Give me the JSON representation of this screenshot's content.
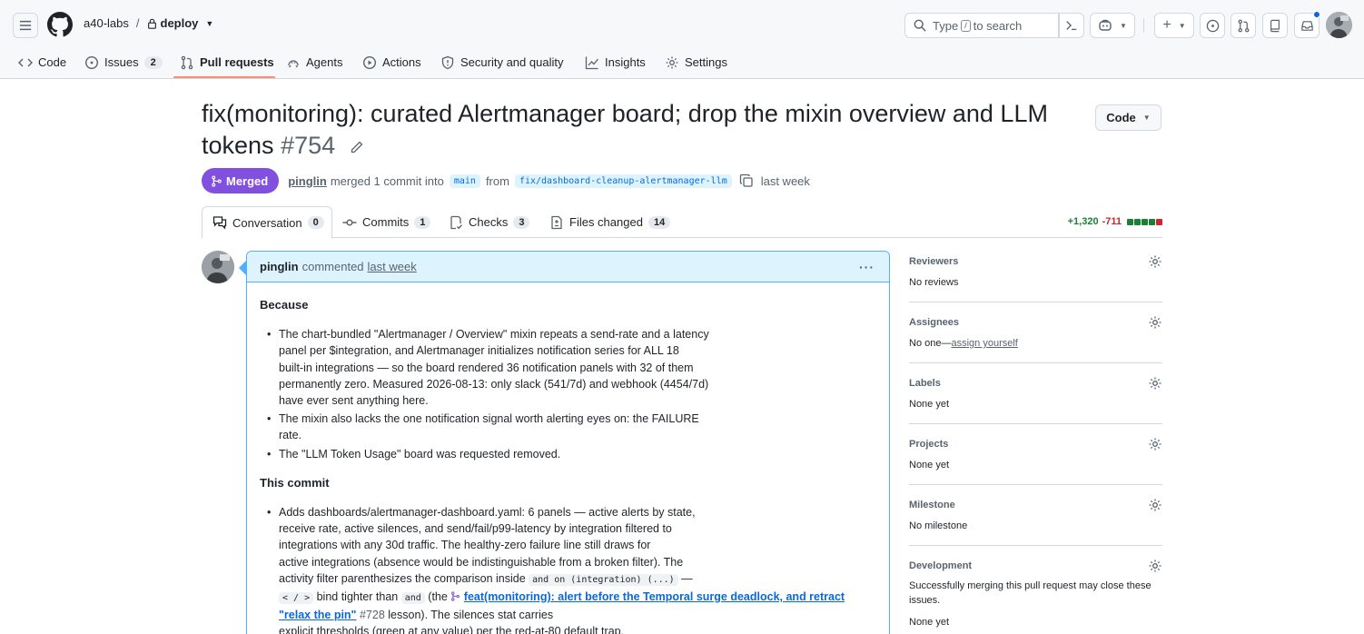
{
  "header": {
    "org": "a40-labs",
    "repo": "deploy",
    "search_prefix": "Type",
    "search_kbd": "/",
    "search_suffix": "to search",
    "plus": "+"
  },
  "repo_nav": [
    {
      "label": "Code",
      "icon": "code-icon"
    },
    {
      "label": "Issues",
      "count": "2",
      "icon": "issue-icon"
    },
    {
      "label": "Pull requests",
      "icon": "git-pull-request-icon",
      "active": true
    },
    {
      "label": "Agents",
      "icon": "agents-icon"
    },
    {
      "label": "Actions",
      "icon": "play-icon"
    },
    {
      "label": "Security and quality",
      "icon": "shield-icon"
    },
    {
      "label": "Insights",
      "icon": "graph-icon"
    },
    {
      "label": "Settings",
      "icon": "gear-icon"
    }
  ],
  "pr": {
    "title": "fix(monitoring): curated Alertmanager board; drop the mixin overview and LLM tokens",
    "number": "#754",
    "code_button": "Code",
    "state": "Merged",
    "author": "pinglin",
    "merged_text": "merged 1 commit into",
    "base_branch": "main",
    "from_text": "from",
    "head_branch": "fix/dashboard-cleanup-alertmanager-llm",
    "when": "last week"
  },
  "tabs": [
    {
      "label": "Conversation",
      "count": "0",
      "icon": "comment-discussion-icon"
    },
    {
      "label": "Commits",
      "count": "1",
      "icon": "git-commit-icon"
    },
    {
      "label": "Checks",
      "count": "3",
      "icon": "checklist-icon"
    },
    {
      "label": "Files changed",
      "count": "14",
      "icon": "file-diff-icon"
    }
  ],
  "diffstat": {
    "additions": "+1,320",
    "deletions": "-711",
    "blocks": [
      "#1a7f37",
      "#1a7f37",
      "#1a7f37",
      "#1a7f37",
      "#d1242f"
    ]
  },
  "comment": {
    "author": "pinglin",
    "action": "commented",
    "when": "last week",
    "heading1": "Because",
    "because": [
      [
        "The chart-bundled \"Alertmanager / Overview\" mixin repeats a send-rate and a latency",
        "panel per $integration, and Alertmanager initializes notification series for ALL 18",
        "built-in integrations — so the board rendered 36 notification panels with 32 of them",
        "permanently zero. Measured 2026-08-13: only slack (541/7d) and webhook (4454/7d)",
        "have ever sent anything here."
      ],
      [
        "The mixin also lacks the one notification signal worth alerting eyes on: the FAILURE",
        "rate."
      ],
      [
        "The \"LLM Token Usage\" board was requested removed."
      ]
    ],
    "heading2": "This commit",
    "commit_lines": [
      "Adds dashboards/alertmanager-dashboard.yaml: 6 panels — active alerts by state,",
      "receive rate, active silences, and send/fail/p99-latency by integration filtered to",
      "integrations with any 30d traffic. The healthy-zero failure line still draws for",
      "active integrations (absence would be indistinguishable from a broken filter). The",
      "activity filter parenthesizes the comparison inside"
    ],
    "code_and_on": "and on (integration) (...)",
    "dash": "—",
    "code_cmp": "< / >",
    "bind_text": "bind tighter than",
    "code_and": "and",
    "the_text": "(the",
    "ref_title_1": "feat(monitoring): alert before the Temporal surge deadlock, and retract",
    "ref_title_2": "\"relax the pin\"",
    "ref_num": "#728",
    "after_ref": "lesson). The silences stat carries",
    "last_line": "explicit thresholds (green at any value) per the red-at-80 default trap."
  },
  "sidebar": {
    "reviewers": {
      "title": "Reviewers",
      "value": "No reviews"
    },
    "assignees": {
      "title": "Assignees",
      "value_prefix": "No one—",
      "link": "assign yourself"
    },
    "labels": {
      "title": "Labels",
      "value": "None yet"
    },
    "projects": {
      "title": "Projects",
      "value": "None yet"
    },
    "milestone": {
      "title": "Milestone",
      "value": "No milestone"
    },
    "development": {
      "title": "Development",
      "value": "Successfully merging this pull request may close these issues.",
      "value2": "None yet"
    }
  },
  "colors": {
    "merged": "#8250df",
    "accent": "#0969da",
    "nav_underline": "#fd8c73",
    "comment_border": "#54aeff",
    "comment_header": "#ddf4ff"
  }
}
